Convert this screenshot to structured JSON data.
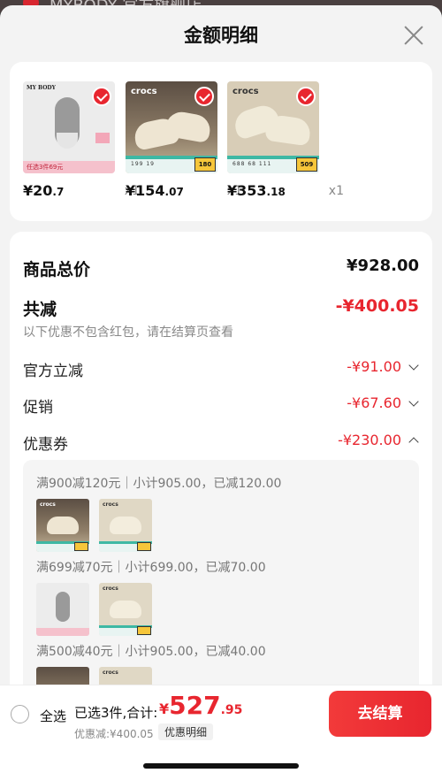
{
  "background": {
    "store_name": "MYBODY 官方旗舰店"
  },
  "header": {
    "title": "金额明细",
    "close_icon": "close-icon"
  },
  "products": [
    {
      "brand": "MY BODY",
      "promo": "任选3件69元",
      "price_int": "¥20",
      "price_dec": ".7",
      "qty": "x1",
      "selected": true
    },
    {
      "brand": "crocs",
      "thumb_nums": "199    19",
      "thumb_price": "180",
      "price_int": "¥154",
      "price_dec": ".07",
      "qty": "x1",
      "selected": true
    },
    {
      "brand": "crocs",
      "thumb_nums": "688   68   111",
      "thumb_price": "509",
      "price_int": "¥353",
      "price_dec": ".18",
      "qty": "x1",
      "selected": true
    }
  ],
  "summary": {
    "total_label": "商品总价",
    "total_value": "¥928.00",
    "reduce_label": "共减",
    "reduce_value": "-¥400.05",
    "note": "以下优惠不包含红包，请在结算页查看",
    "official_label": "官方立减",
    "official_value": "-¥91.00",
    "promo_label": "促销",
    "promo_value": "-¥67.60",
    "coupon_label": "优惠券",
    "coupon_value": "-¥230.00"
  },
  "coupons": [
    {
      "text": "满900减120元｜小计905.00，已减120.00"
    },
    {
      "text": "满699减70元｜小计699.00，已减70.00"
    },
    {
      "text": "满500减40元｜小计905.00，已减40.00"
    }
  ],
  "footer": {
    "select_all": "全选",
    "selected_text": "已选3件,合计:",
    "total_yen": "¥",
    "total_int": "527",
    "total_dec": ".95",
    "discount_text": "优惠减:¥400.05",
    "detail_chip": "优惠明细",
    "checkout_label": "去结算"
  },
  "colors": {
    "accent": "#e8262f",
    "background": "#f3f3f3"
  }
}
